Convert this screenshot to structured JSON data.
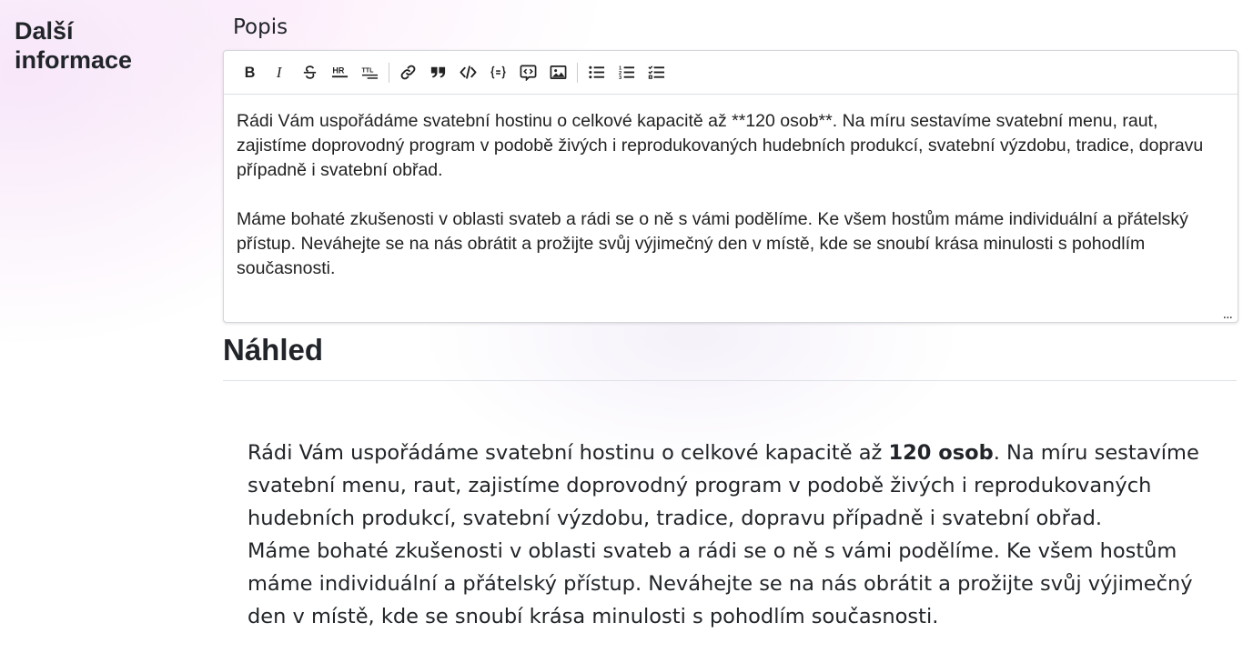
{
  "section": {
    "title": "Další informace"
  },
  "field": {
    "label": "Popis"
  },
  "toolbar": {
    "buttons": [
      {
        "icon": "bold-icon",
        "label": "B"
      },
      {
        "icon": "italic-icon",
        "label": "I"
      },
      {
        "icon": "strikethrough-icon"
      },
      {
        "icon": "horizontal-rule-icon",
        "label": "HR"
      },
      {
        "icon": "title-icon",
        "label": "TTL"
      },
      {
        "icon": "link-icon"
      },
      {
        "icon": "quote-icon"
      },
      {
        "icon": "code-icon"
      },
      {
        "icon": "code-block-icon"
      },
      {
        "icon": "embed-icon"
      },
      {
        "icon": "image-icon"
      },
      {
        "icon": "unordered-list-icon"
      },
      {
        "icon": "ordered-list-icon"
      },
      {
        "icon": "task-list-icon"
      }
    ]
  },
  "editor": {
    "text": "Rádi Vám uspořádáme svatební hostinu o celkové kapacitě až **120 osob**. Na míru sestavíme svatební menu, raut, zajistíme doprovodný program v podobě živých i reprodukovaných hudebních produkcí, svatební výzdobu, tradice, dopravu případně i svatební obřad.\n\nMáme bohaté zkušenosti v oblasti svateb a rádi se o ně s vámi podělíme. Ke všem hostům máme individuální a přátelský přístup. Neváhejte se na nás obrátit a prožijte svůj výjimečný den v místě, kde se snoubí krása minulosti s pohodlím současnosti.",
    "resize_glyph": "..."
  },
  "preview": {
    "title": "Náhled",
    "p1_before": "Rádi Vám uspořádáme svatební hostinu o celkové kapacitě až ",
    "p1_bold": "120 osob",
    "p1_after": ". Na míru sestavíme svatební menu, raut, zajistíme doprovodný program v podobě živých i reprodukovaných hudebních produkcí, svatební výzdobu, tradice, dopravu případně i svatební obřad.",
    "p2": "Máme bohaté zkušenosti v oblasti svateb a rádi se o ně s vámi podělíme. Ke všem hostům máme individuální a přátelský přístup. Neváhejte se na nás obrátit a prožijte svůj výjimečný den v místě, kde se snoubí krása minulosti s pohodlím současnosti."
  }
}
